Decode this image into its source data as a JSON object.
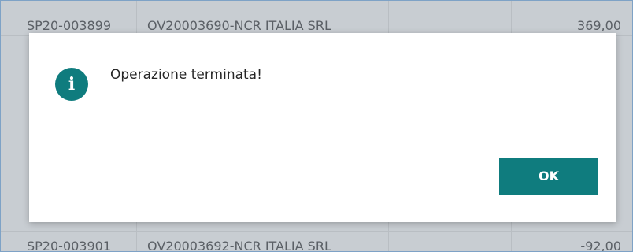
{
  "background_rows": [
    {
      "code": "SP20-003899",
      "description": "OV20003690-NCR ITALIA SRL",
      "amount": "369,00"
    },
    {
      "code": "SP20-003901",
      "description": "OV20003692-NCR ITALIA SRL",
      "amount": "-92,00"
    }
  ],
  "dialog": {
    "icon": "info-icon",
    "icon_glyph": "i",
    "message": "Operazione terminata!",
    "ok_label": "OK"
  },
  "colors": {
    "accent": "#0f7c7e",
    "overlay": "#c8cdd2",
    "dialog_bg": "#ffffff"
  }
}
